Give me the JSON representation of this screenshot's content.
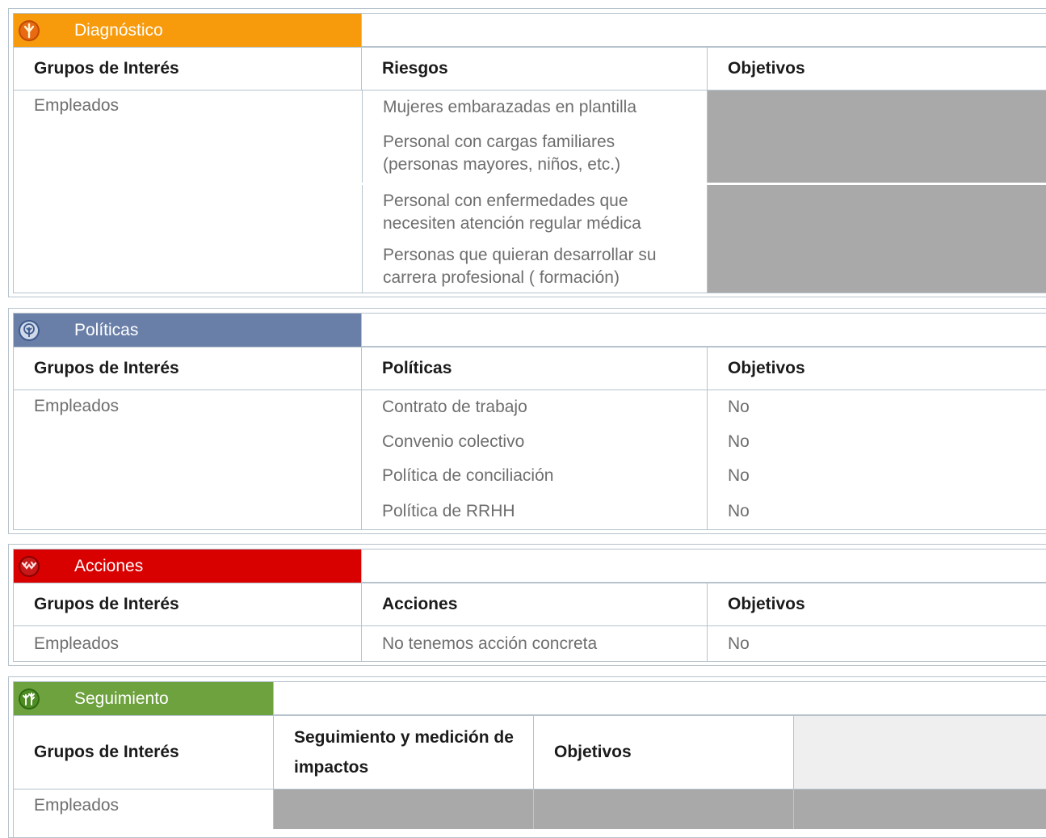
{
  "diagnostico": {
    "title": "Diagnóstico",
    "color": "#f79a0c",
    "icon": "tree-icon",
    "headers": [
      "Grupos de Interés",
      "Riesgos",
      "Objetivos"
    ],
    "group": "Empleados",
    "risks": [
      "Mujeres embarazadas en plantilla",
      "Personal con cargas familiares (personas mayores, niños, etc.)",
      "Personal con enfermedades que necesiten atención regular médica",
      "Personas que quieran desarrollar su carrera profesional ( formación)"
    ]
  },
  "politicas": {
    "title": "Políticas",
    "color": "#6a7fa8",
    "icon": "tree-outline-icon",
    "headers": [
      "Grupos de Interés",
      "Políticas",
      "Objetivos"
    ],
    "group": "Empleados",
    "rows": [
      {
        "policy": "Contrato de trabajo",
        "objective": "No"
      },
      {
        "policy": "Convenio colectivo",
        "objective": "No"
      },
      {
        "policy": "Política de conciliación",
        "objective": "No"
      },
      {
        "policy": "Política de RRHH",
        "objective": "No"
      }
    ]
  },
  "acciones": {
    "title": "Acciones",
    "color": "#d90000",
    "icon": "handshake-icon",
    "headers": [
      "Grupos de Interés",
      "Acciones",
      "Objetivos"
    ],
    "group": "Empleados",
    "action": "No tenemos acción concreta",
    "objective": "No"
  },
  "seguimiento": {
    "title": "Seguimiento",
    "color": "#6ea23e",
    "icon": "plants-icon",
    "headers": [
      "Grupos de Interés",
      "Seguimiento y medición de impactos",
      "Objetivos"
    ],
    "group": "Empleados"
  }
}
